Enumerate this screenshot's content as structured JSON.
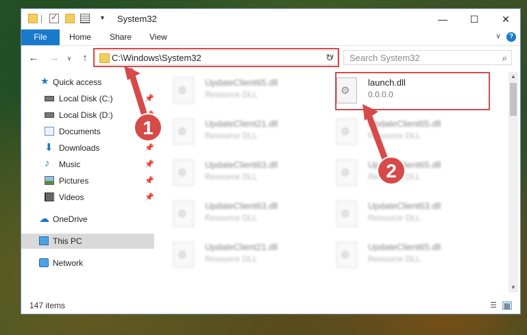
{
  "window": {
    "title": "System32",
    "controls": {
      "minimize": "—",
      "maximize": "☐",
      "close": "✕"
    }
  },
  "ribbon": {
    "file_tab": "File",
    "tabs": [
      "Home",
      "Share",
      "View"
    ],
    "help": "?",
    "collapse": "∨"
  },
  "nav": {
    "back": "←",
    "forward": "→",
    "recent": "∨",
    "up": "↑",
    "address": "C:\\Windows\\System32",
    "address_dropdown": "∨",
    "refresh": "↻",
    "search_placeholder": "Search System32",
    "search_icon": "⌕"
  },
  "sidebar": {
    "items": [
      {
        "label": "Quick access",
        "icon": "star-icon",
        "pinned": false
      },
      {
        "label": "Local Disk (C:)",
        "icon": "drive-icon",
        "pinned": true
      },
      {
        "label": "Local Disk (D:)",
        "icon": "drive-icon",
        "pinned": true
      },
      {
        "label": "Documents",
        "icon": "document-icon",
        "pinned": true
      },
      {
        "label": "Downloads",
        "icon": "download-icon",
        "pinned": true
      },
      {
        "label": "Music",
        "icon": "music-icon",
        "pinned": true
      },
      {
        "label": "Pictures",
        "icon": "picture-icon",
        "pinned": true
      },
      {
        "label": "Videos",
        "icon": "video-icon",
        "pinned": true
      },
      {
        "label": "OneDrive",
        "icon": "cloud-icon",
        "pinned": false
      },
      {
        "label": "This PC",
        "icon": "computer-icon",
        "pinned": false,
        "selected": true
      },
      {
        "label": "Network",
        "icon": "network-icon",
        "pinned": false
      }
    ],
    "pin_glyph": "📌"
  },
  "files": [
    {
      "name": "UpdateClient65.dll",
      "sub": "Resource DLL",
      "blurred": true
    },
    {
      "name": "launch.dll",
      "sub": "0.0.0.0",
      "blurred": false,
      "highlighted": true
    },
    {
      "name": "UpdateClient21.dll",
      "sub": "Resource DLL",
      "blurred": true
    },
    {
      "name": "UpdateClient65.dll",
      "sub": "Resource DLL",
      "blurred": true
    },
    {
      "name": "UpdateClient63.dll",
      "sub": "Resource DLL",
      "blurred": true
    },
    {
      "name": "UpdateClient65.dll",
      "sub": "Resource DLL",
      "blurred": true
    },
    {
      "name": "UpdateClient63.dll",
      "sub": "Resource DLL",
      "blurred": true
    },
    {
      "name": "UpdateClient63.dll",
      "sub": "Resource DLL",
      "blurred": true
    },
    {
      "name": "UpdateClient21.dll",
      "sub": "Resource DLL",
      "blurred": true
    },
    {
      "name": "UpdateClient65.dll",
      "sub": "Resource DLL",
      "blurred": true
    }
  ],
  "status": {
    "item_count": "147 items"
  },
  "annotations": {
    "step1": "1",
    "step2": "2",
    "color": "#d64a4a"
  },
  "colors": {
    "accent": "#1979ca",
    "highlight": "#d64a4a",
    "selected_bg": "#d9d9d9"
  }
}
